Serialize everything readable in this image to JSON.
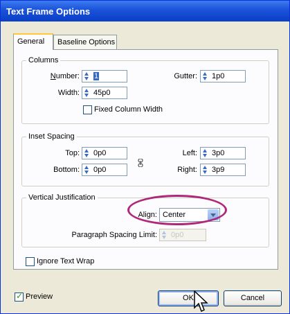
{
  "window": {
    "title": "Text Frame Options"
  },
  "tabs": [
    {
      "label": "General",
      "active": true
    },
    {
      "label": "Baseline Options",
      "active": false
    }
  ],
  "columns": {
    "title": "Columns",
    "number_label": "Number:",
    "number_value": "1",
    "width_label": "Width:",
    "width_value": "45p0",
    "gutter_label": "Gutter:",
    "gutter_value": "1p0",
    "fixed_width_label": "Fixed Column Width",
    "fixed_width_checked": false
  },
  "inset": {
    "title": "Inset Spacing",
    "top_label": "Top:",
    "top_value": "0p0",
    "bottom_label": "Bottom:",
    "bottom_value": "0p0",
    "left_label": "Left:",
    "left_value": "3p0",
    "right_label": "Right:",
    "right_value": "3p9"
  },
  "vertical": {
    "title": "Vertical Justification",
    "align_label": "Align:",
    "align_value": "Center",
    "para_spacing_label": "Paragraph Spacing Limit:",
    "para_spacing_value": "0p0"
  },
  "ignore_wrap": {
    "label": "Ignore Text Wrap",
    "checked": false
  },
  "preview": {
    "label": "Preview",
    "checked": true
  },
  "buttons": {
    "ok": "OK",
    "cancel": "Cancel"
  },
  "colors": {
    "accent": "#b0287a",
    "titlebar": "#0a3fc8",
    "dialog_bg": "#ece9d8"
  }
}
